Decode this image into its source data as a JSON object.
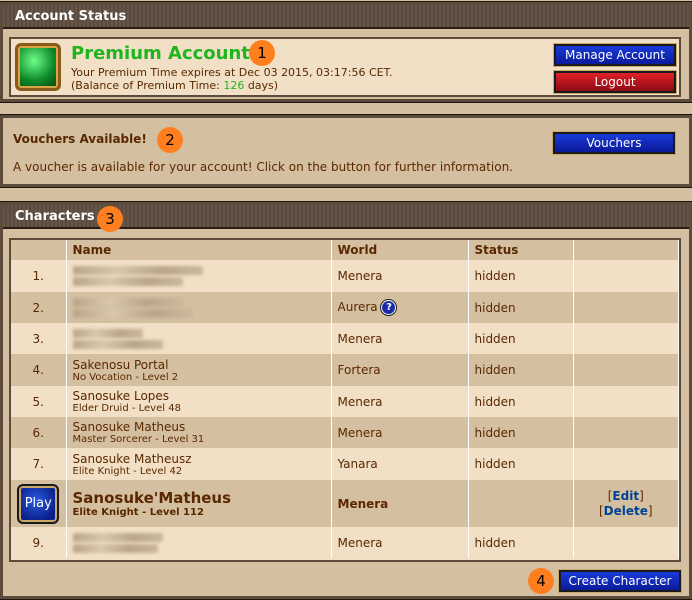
{
  "account": {
    "header": "Account Status",
    "title": "Premium Account",
    "expires_text": "Your Premium Time expires at Dec 03 2015, 03:17:56 CET.",
    "balance_prefix": "(Balance of Premium Time: ",
    "balance_days": "126",
    "balance_suffix": " days)",
    "manage_label": "Manage Account",
    "logout_label": "Logout",
    "badge": "1"
  },
  "vouchers": {
    "title": "Vouchers Available!",
    "text": "A voucher is available for your account! Click on the button for further information.",
    "button_label": "Vouchers",
    "badge": "2"
  },
  "characters": {
    "header": "Characters",
    "badge": "3",
    "columns": [
      "Name",
      "World",
      "Status"
    ],
    "rows": [
      {
        "num": "1.",
        "name": "",
        "sub": "",
        "world": "Menera",
        "status": "hidden",
        "blurred": true
      },
      {
        "num": "2.",
        "name": "",
        "sub": "",
        "world": "Aurera",
        "status": "hidden",
        "blurred": true
      },
      {
        "num": "3.",
        "name": "",
        "sub": "",
        "world": "Menera",
        "status": "hidden",
        "blurred": true
      },
      {
        "num": "4.",
        "name": "Sakenosu Portal",
        "sub": "No Vocation - Level 2",
        "world": "Fortera",
        "status": "hidden"
      },
      {
        "num": "5.",
        "name": "Sanosuke Lopes",
        "sub": "Elder Druid - Level 48",
        "world": "Menera",
        "status": "hidden"
      },
      {
        "num": "6.",
        "name": "Sanosuke Matheus",
        "sub": "Master Sorcerer - Level 31",
        "world": "Menera",
        "status": "hidden"
      },
      {
        "num": "7.",
        "name": "Sanosuke Matheusz",
        "sub": "Elite Knight - Level 42",
        "world": "Yanara",
        "status": "hidden"
      }
    ],
    "selected": {
      "play_label": "Play",
      "name": "Sanosuke'Matheus",
      "sub": "Elite Knight - Level 112",
      "world": "Menera",
      "edit_label": "Edit",
      "delete_label": "Delete"
    },
    "last_row": {
      "num": "9.",
      "world": "Menera",
      "status": "hidden"
    },
    "create_label": "Create Character",
    "create_badge": "4"
  }
}
